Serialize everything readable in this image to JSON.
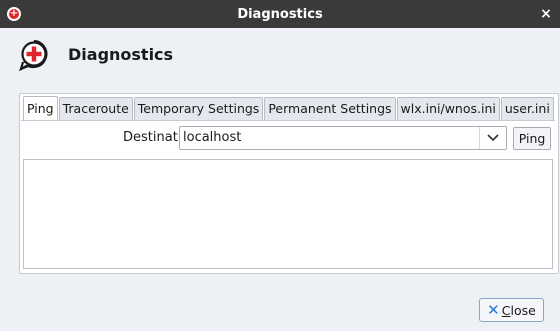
{
  "window": {
    "title": "Diagnostics",
    "close_glyph": "×"
  },
  "header": {
    "title": "Diagnostics",
    "icon": "red-plus-chat-icon"
  },
  "tabs": [
    {
      "label": "Ping",
      "active": true
    },
    {
      "label": "Traceroute",
      "active": false
    },
    {
      "label": "Temporary Settings",
      "active": false
    },
    {
      "label": "Permanent Settings",
      "active": false
    },
    {
      "label": "wlx.ini/wnos.ini",
      "active": false
    },
    {
      "label": "user.ini",
      "active": false
    }
  ],
  "ping": {
    "destination_label": "Destination:",
    "destination_value": "localhost",
    "ping_button": "Ping",
    "output": ""
  },
  "footer": {
    "close_accel": "C",
    "close_rest": "lose"
  },
  "colors": {
    "titlebar": "#3a3a3a",
    "accent_red": "#e0262c",
    "close_icon_blue": "#2d7bd6",
    "background": "#edf0f5"
  }
}
